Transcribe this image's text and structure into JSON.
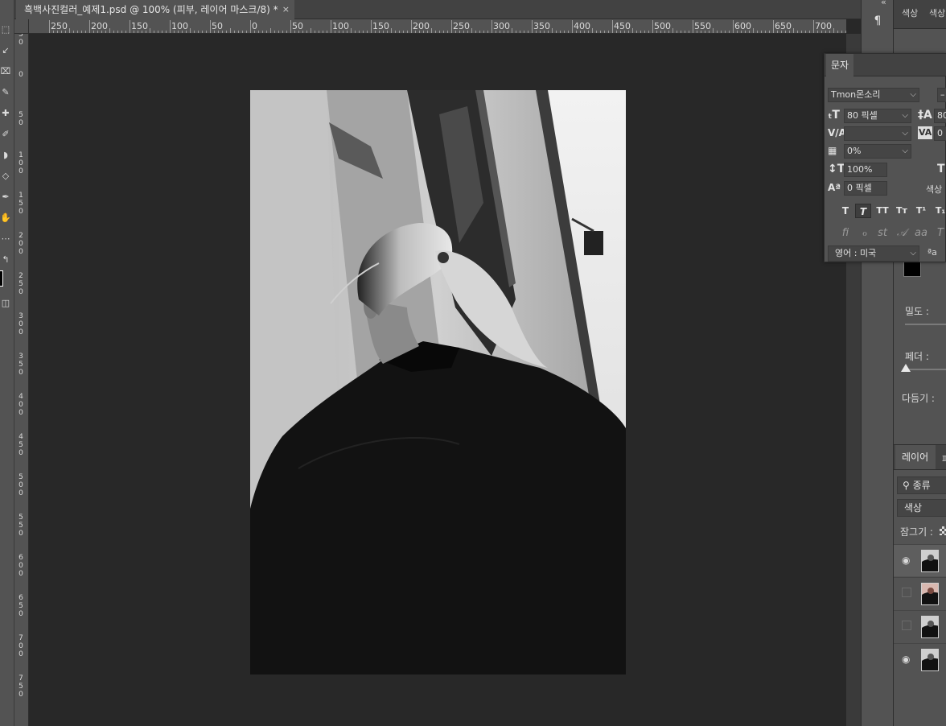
{
  "document": {
    "tab_title": "흑백사진컬러_예제1.psd @ 100% (피부, 레이어 마스크/8) *",
    "close_glyph": "×"
  },
  "ruler": {
    "h_labels": [
      "250",
      "200",
      "150",
      "100",
      "50",
      "0",
      "50",
      "100",
      "150",
      "200",
      "250",
      "300",
      "350",
      "400",
      "450",
      "500",
      "550",
      "600",
      "650",
      "700"
    ],
    "v_labels": [
      "5 0",
      "0",
      "5 0",
      "1 0 0",
      "1 5 0",
      "2 0 0",
      "2 5 0",
      "3 0 0",
      "3 5 0",
      "4 0 0",
      "4 5 0",
      "5 0 0",
      "5 5 0",
      "6 0 0",
      "6 5 0",
      "7 0 0",
      "7 5 0"
    ]
  },
  "dock": {
    "tab_color1": "색상",
    "tab_color2": "색상",
    "density_label": "밀도 :",
    "feather_label": "페더 :",
    "refine_label": "다듬기 :",
    "layers_tab": "레이어",
    "paths_tab_partial": "패",
    "filter_kind": "종류",
    "blend_mode": "색상",
    "lock_label": "잠그기 :",
    "layers": [
      {
        "visible": true,
        "thumb": "bw-photo"
      },
      {
        "visible": false,
        "thumb": "color-photo"
      },
      {
        "visible": false,
        "thumb": "bw-photo"
      },
      {
        "visible": true,
        "thumb": "bw-photo"
      }
    ]
  },
  "character": {
    "tab": "문자",
    "font_family": "Tmon몬소리",
    "font_size": "80 픽셀",
    "leading_partial": "80",
    "kerning": "",
    "tracking_partial": "0",
    "scale_tsume": "0%",
    "vertical_scale": "100%",
    "baseline_shift": "0 픽셀",
    "color_label_partial": "색상",
    "language": "영어 : 미국",
    "aa_glyph": "ªa"
  },
  "colors": {
    "app_bg": "#282828",
    "panel_bg": "#535353",
    "tab_bar_bg": "#424242",
    "field_bg": "#454545",
    "text": "#d4d4d4"
  },
  "icons": [
    "marquee-icon",
    "lasso-icon",
    "crop-icon",
    "eyedropper-icon",
    "healing-icon",
    "brush-icon",
    "stamp-icon",
    "eraser-icon",
    "pen-icon",
    "hand-icon",
    "zoom-icon",
    "foreground-color-icon",
    "screen-mode-icon",
    "paragraph-icon",
    "eye-icon",
    "search-icon",
    "checkerboard-lock-icon"
  ]
}
